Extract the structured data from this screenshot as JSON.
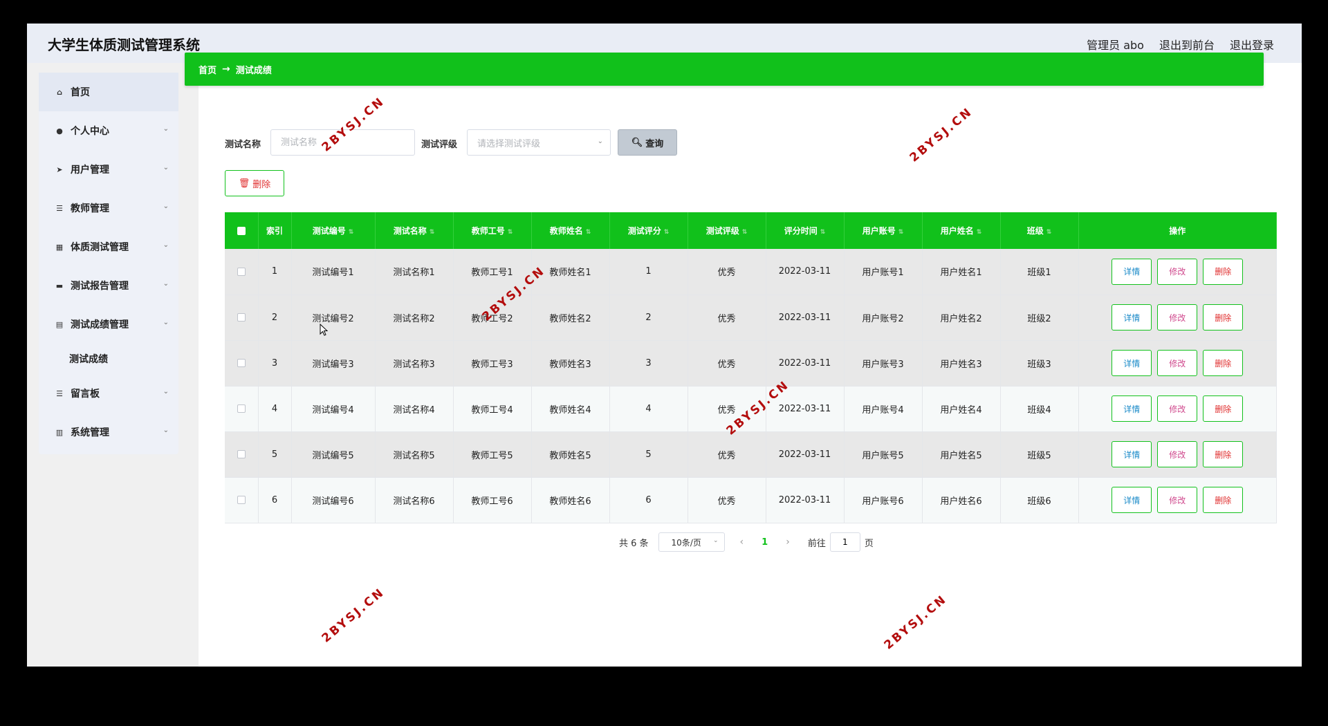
{
  "app": {
    "title": "大学生体质测试管理系统",
    "top_links": [
      "管理员 abo",
      "退出到前台",
      "退出登录"
    ]
  },
  "sidebar": {
    "items": [
      {
        "label": "首页",
        "icon": "home-icon"
      },
      {
        "label": "个人中心",
        "icon": "user-icon"
      },
      {
        "label": "用户管理",
        "icon": "send-icon"
      },
      {
        "label": "教师管理",
        "icon": "list-icon"
      },
      {
        "label": "体质测试管理",
        "icon": "grid-icon"
      },
      {
        "label": "测试报告管理",
        "icon": "monitor-icon"
      },
      {
        "label": "测试成绩管理",
        "icon": "document-icon"
      },
      {
        "label": "留言板",
        "icon": "list-icon"
      },
      {
        "label": "系统管理",
        "icon": "chart-icon"
      }
    ],
    "sub_item": "测试成绩"
  },
  "breadcrumb": {
    "home": "首页",
    "separator": "→",
    "current": "测试成绩"
  },
  "search": {
    "name_label": "测试名称",
    "name_placeholder": "测试名称",
    "grade_label": "测试评级",
    "grade_placeholder": "请选择测试评级",
    "query_label": "查询"
  },
  "bulk_delete_label": "删除",
  "table": {
    "columns": [
      "索引",
      "测试编号",
      "测试名称",
      "教师工号",
      "教师姓名",
      "测试评分",
      "测试评级",
      "评分时间",
      "用户账号",
      "用户姓名",
      "班级",
      "操作"
    ],
    "rows": [
      [
        "1",
        "测试编号1",
        "测试名称1",
        "教师工号1",
        "教师姓名1",
        "1",
        "优秀",
        "2022-03-11",
        "用户账号1",
        "用户姓名1",
        "班级1"
      ],
      [
        "2",
        "测试编号2",
        "测试名称2",
        "教师工号2",
        "教师姓名2",
        "2",
        "优秀",
        "2022-03-11",
        "用户账号2",
        "用户姓名2",
        "班级2"
      ],
      [
        "3",
        "测试编号3",
        "测试名称3",
        "教师工号3",
        "教师姓名3",
        "3",
        "优秀",
        "2022-03-11",
        "用户账号3",
        "用户姓名3",
        "班级3"
      ],
      [
        "4",
        "测试编号4",
        "测试名称4",
        "教师工号4",
        "教师姓名4",
        "4",
        "优秀",
        "2022-03-11",
        "用户账号4",
        "用户姓名4",
        "班级4"
      ],
      [
        "5",
        "测试编号5",
        "测试名称5",
        "教师工号5",
        "教师姓名5",
        "5",
        "优秀",
        "2022-03-11",
        "用户账号5",
        "用户姓名5",
        "班级5"
      ],
      [
        "6",
        "测试编号6",
        "测试名称6",
        "教师工号6",
        "教师姓名6",
        "6",
        "优秀",
        "2022-03-11",
        "用户账号6",
        "用户姓名6",
        "班级6"
      ]
    ],
    "actions": {
      "detail": "详情",
      "edit": "修改",
      "delete": "删除"
    }
  },
  "pagination": {
    "total": "共 6 条",
    "page_size": "10条/页",
    "prev": "‹",
    "current_page": "1",
    "next": "›",
    "goto_label": "前往",
    "goto_value": "1",
    "page_suffix": "页"
  },
  "watermark_text": "2BYSJ.CN",
  "colors": {
    "accent": "#11c11b",
    "delete": "#e03030",
    "detail": "#1a8ac8",
    "edit": "#d04a8e",
    "watermark": "#b30d0d"
  }
}
